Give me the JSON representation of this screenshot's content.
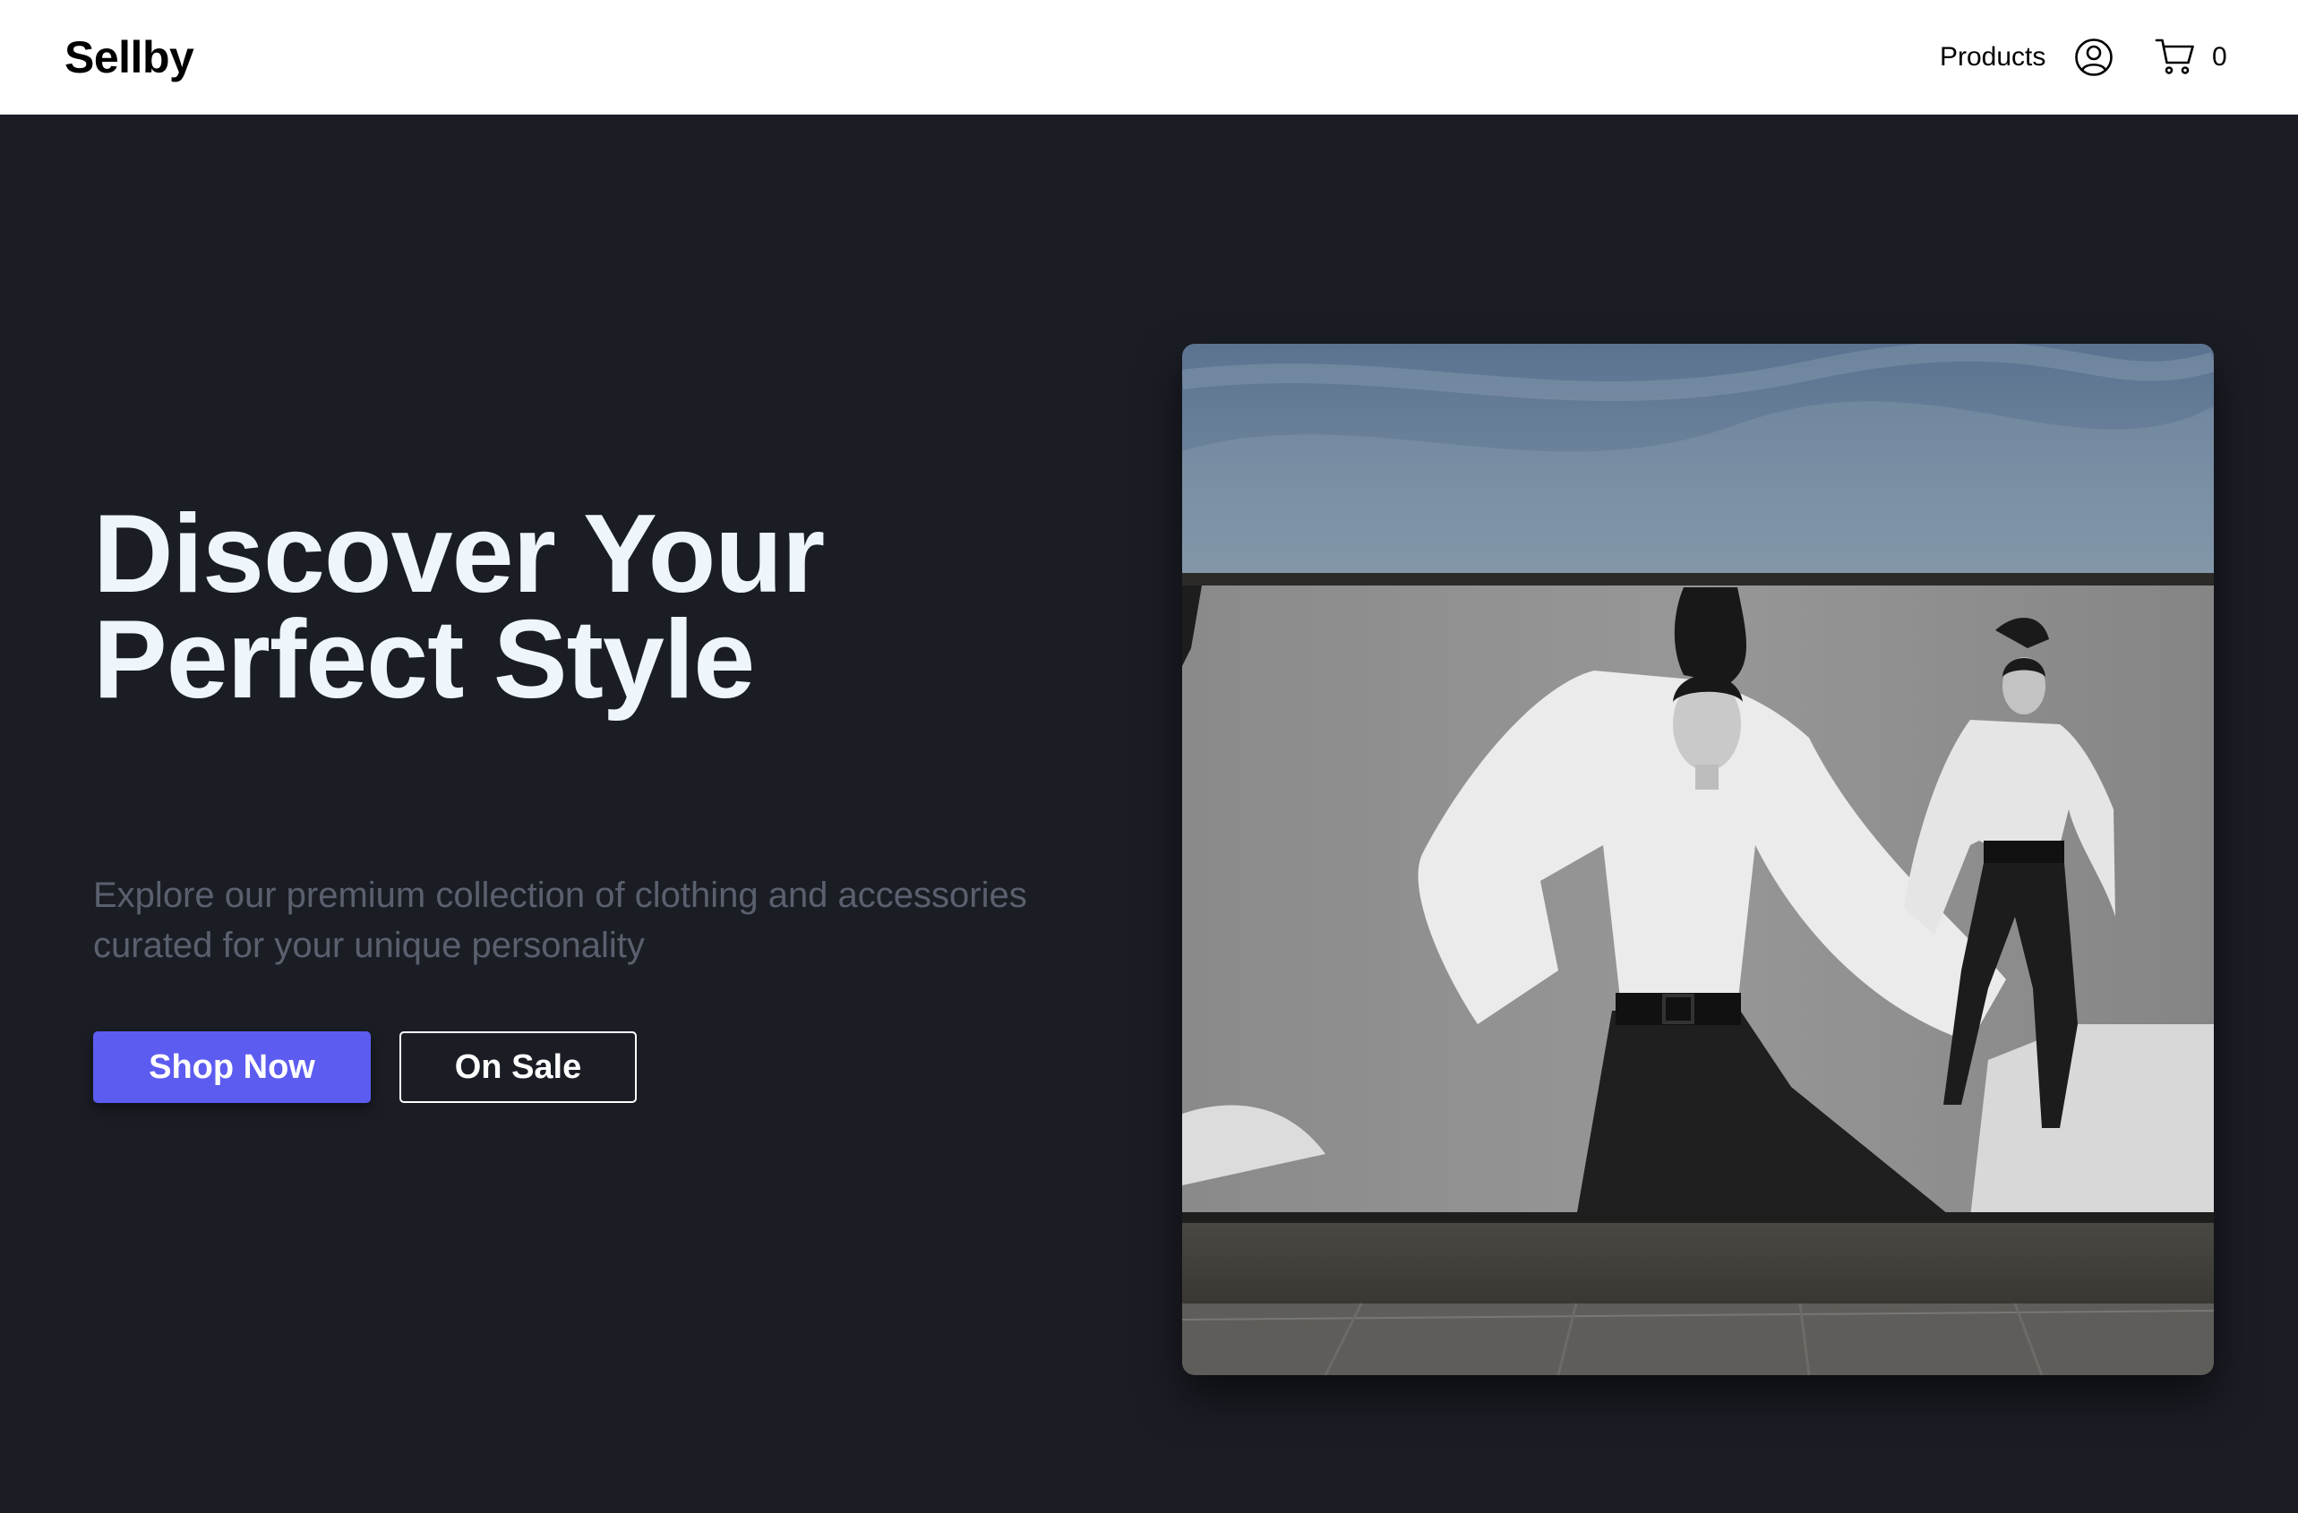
{
  "header": {
    "logo": "Sellby",
    "nav": {
      "products_label": "Products",
      "account_icon": "user-circle-icon",
      "cart_icon": "shopping-cart-icon",
      "cart_count": "0"
    }
  },
  "hero": {
    "title_line1": "Discover Your",
    "title_line2": "Perfect Style",
    "subtitle_line1": "Explore our premium collection of clothing and accessories",
    "subtitle_line2": "curated for your unique personality",
    "primary_button": "Shop Now",
    "secondary_button": "On Sale"
  },
  "colors": {
    "background": "#1b1d25",
    "header_bg": "#ffffff",
    "title": "#eef5fb",
    "subtitle": "#5a606e",
    "accent": "#5d5cf0"
  }
}
